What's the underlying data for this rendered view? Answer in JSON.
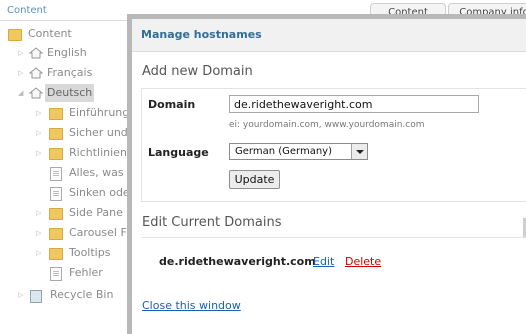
{
  "background": {
    "header_title": "Content",
    "tabs": [
      "Content",
      "Company info"
    ],
    "tree": {
      "root": "Content",
      "items": [
        {
          "label": "English",
          "icon": "home-icon"
        },
        {
          "label": "Français",
          "icon": "home-icon"
        },
        {
          "label": "Deutsch",
          "icon": "home-icon",
          "selected": true
        },
        {
          "label": "Einführung",
          "icon": "folder-icon"
        },
        {
          "label": "Sicher und",
          "icon": "folder-icon"
        },
        {
          "label": "Richtlinien",
          "icon": "folder-icon"
        },
        {
          "label": "Alles, was",
          "icon": "doc-icon"
        },
        {
          "label": "Sinken ode",
          "icon": "doc-icon"
        },
        {
          "label": "Side Pane",
          "icon": "folder-icon"
        },
        {
          "label": "Carousel F",
          "icon": "folder-icon"
        },
        {
          "label": "Tooltips",
          "icon": "folder-icon"
        },
        {
          "label": "Fehler",
          "icon": "doc-icon"
        },
        {
          "label": "Recycle Bin",
          "icon": "bin-icon"
        }
      ]
    }
  },
  "modal": {
    "title": "Manage hostnames",
    "add_heading": "Add new Domain",
    "domain_label": "Domain",
    "domain_value": "de.ridethewaveright.com",
    "domain_hint": "ei: yourdomain.com, www.yourdomain.com",
    "language_label": "Language",
    "language_selected": "German (Germany)",
    "update_button": "Update",
    "edit_heading": "Edit Current Domains",
    "current_domain": "de.ridethewaveright.com",
    "edit_link": "Edit",
    "delete_link": "Delete",
    "close_link": "Close this window"
  },
  "colors": {
    "title_blue": "#2f6e99",
    "link_blue": "#1a5fb4",
    "delete_red": "#cc0000",
    "modal_border": "#b8b8b8"
  }
}
